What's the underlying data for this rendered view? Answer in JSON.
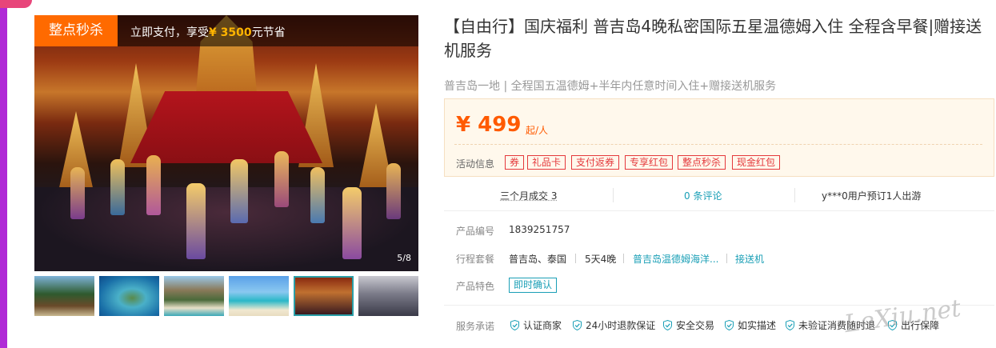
{
  "gallery": {
    "promo_badge": "整点秒杀",
    "promo_prefix": "立即支付，享受",
    "promo_amount": "¥ 3500",
    "promo_suffix": "元节省",
    "counter": "5/8",
    "thumbnails": [
      "beach-resort",
      "island-aerial",
      "limestone-cliffs",
      "blue-beach",
      "thai-dance-show",
      "hotel-gym"
    ],
    "active_thumb": 4
  },
  "product": {
    "title": "【自由行】国庆福利 普吉岛4晚私密国际五星温德姆入住 全程含早餐|赠接送机服务",
    "subtitle": "普吉岛一地 | 全程国五温德姆+半年内任意时间入住+赠接送机服务"
  },
  "price": {
    "value": "¥ 499",
    "unit": "起/人",
    "activity_label": "活动信息",
    "tags": [
      "券",
      "礼品卡",
      "支付返券",
      "专享红包",
      "整点秒杀",
      "现金红包"
    ]
  },
  "stats": {
    "sales": "三个月成交 3",
    "reviews": "0 条评论",
    "bookings": "y***0用户预订1人出游"
  },
  "details": {
    "code_label": "产品编号",
    "code_value": "1839251757",
    "package_label": "行程套餐",
    "package_destination": "普吉岛、泰国",
    "package_duration": "5天4晚",
    "package_hotel": "普吉岛温德姆海洋...",
    "package_transfer": "接送机",
    "feature_label": "产品特色",
    "feature_tag": "即时确认",
    "promise_label": "服务承诺",
    "promises": [
      "认证商家",
      "24小时退款保证",
      "安全交易",
      "如实描述",
      "未验证消费随时退",
      "出行保障"
    ]
  },
  "watermark": "LeXiu.net",
  "colors": {
    "accent_orange": "#ff6a00",
    "price_red": "#ff5a00",
    "tag_red": "#e4393c",
    "link_teal": "#1a9fb6",
    "promo_gold": "#ffb400"
  },
  "icons": {
    "promise": "shield-check-icon"
  }
}
